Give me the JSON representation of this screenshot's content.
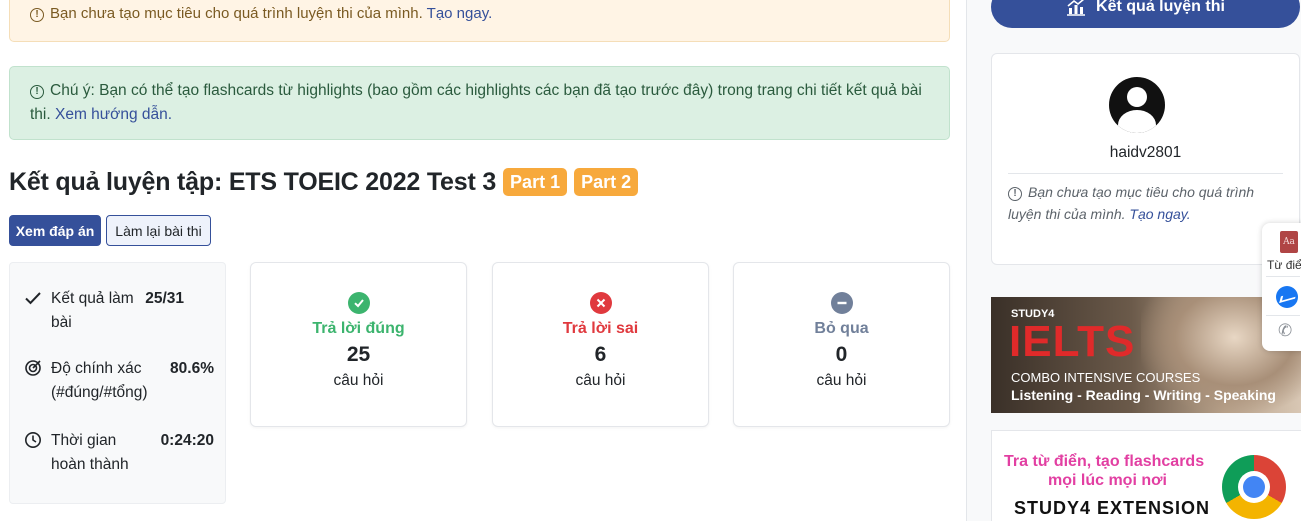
{
  "alerts": {
    "goal_text": "Bạn chưa tạo mục tiêu cho quá trình luyện thi của mình.",
    "goal_link": "Tạo ngay.",
    "note_text": "Chú ý: Bạn có thể tạo flashcards từ highlights (bao gồm các highlights các bạn đã tạo trước đây) trong trang chi tiết kết quả bài thi.",
    "note_link": "Xem hướng dẫn."
  },
  "result": {
    "title": "Kết quả luyện tập: ETS TOEIC 2022 Test 3",
    "parts": [
      "Part 1",
      "Part 2"
    ]
  },
  "buttons": {
    "view_answers": "Xem đáp án",
    "retake": "Làm lại bài thi"
  },
  "stats": {
    "items": [
      {
        "icon": "check-icon",
        "label": "Kết quả làm bài",
        "value": "25/31"
      },
      {
        "icon": "target-icon",
        "label": "Độ chính xác (#đúng/#tổng)",
        "value": "80.6%"
      },
      {
        "icon": "clock-icon",
        "label": "Thời gian hoàn thành",
        "value": "0:24:20"
      }
    ]
  },
  "cards": [
    {
      "icon": "check-circle-icon",
      "label": "Trả lời đúng",
      "count": "25",
      "unit": "câu hỏi",
      "color": "#3cb46e"
    },
    {
      "icon": "x-circle-icon",
      "label": "Trả lời sai",
      "count": "6",
      "unit": "câu hỏi",
      "color": "#e0393e"
    },
    {
      "icon": "minus-circle-icon",
      "label": "Bỏ qua",
      "count": "0",
      "unit": "câu hỏi",
      "color": "#71809a"
    }
  ],
  "sidebar": {
    "results_button": "Kết quả luyện thi",
    "username": "haidv2801",
    "goal_note": "Bạn chưa tạo mục tiêu cho quá trình luyện thi của mình.",
    "goal_link": "Tạo ngay.",
    "ielts_banner": {
      "brand": "STUDY4",
      "headline": "IELTS",
      "line1": "COMBO INTENSIVE COURSES",
      "line2": "Listening - Reading - Writing - Speaking"
    },
    "extension_banner": {
      "line1": "Tra từ điển, tạo flashcards",
      "line2": "mọi lúc mọi nơi",
      "line3": "STUDY4 EXTENSION"
    }
  },
  "float_widget": {
    "dict_label": "Từ điển",
    "dict_glyph": "Aa"
  },
  "colors": {
    "primary": "#35509a",
    "badge": "#f7a93c",
    "correct": "#3cb46e",
    "wrong": "#e0393e",
    "skip": "#71809a"
  }
}
